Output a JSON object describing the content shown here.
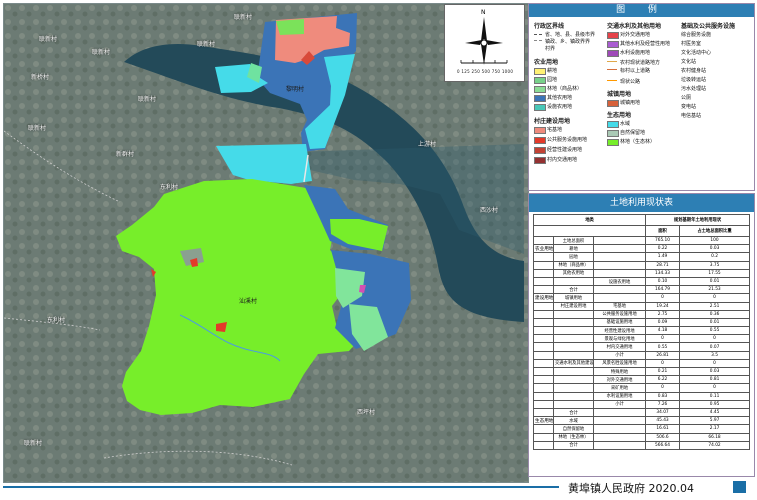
{
  "villages": [
    "联新村",
    "联新村",
    "联新村",
    "联新村",
    "新桥村",
    "联新村",
    "联新村",
    "新群村",
    "黎明村",
    "上游村",
    "西沙村",
    "西坪村",
    "东利村",
    "联新村",
    "汕溪村",
    "东利村"
  ],
  "legend": {
    "title": "图 例",
    "admin": {
      "title": "行政区界线",
      "items": [
        "省、地、县、县级市界",
        "镇政、乡、镇政界界",
        "村界"
      ]
    },
    "agri": {
      "title": "农业用地",
      "items": [
        "耕地",
        "园地",
        "林地（商品林）",
        "其他农用地",
        "设施农用地"
      ]
    },
    "village": {
      "title": "村庄建设用地",
      "items": [
        "宅基地",
        "公共服务设施用地",
        "经营性建设用地",
        "村内交通用地"
      ]
    },
    "traffic": {
      "title": "交通水利及其他用地",
      "items": [
        "对外交通用地",
        "其他水利及经营性用地",
        "水利设施用地",
        "农村现状道路地方",
        "标村以上道路",
        "现状公路"
      ]
    },
    "town": {
      "title": "城镇用地",
      "items": [
        "城镇用地"
      ]
    },
    "eco": {
      "title": "生态用地",
      "items": [
        "水域",
        "自然保留地",
        "林地（生态林）"
      ]
    },
    "facility": {
      "title": "基础及公共服务设施",
      "items": [
        "综合服务设施",
        "村医务室",
        "文化活动中心",
        "文化站",
        "农村健身站",
        "垃圾转运站",
        "污水处理站",
        "公厕",
        "变电站",
        "电信基站"
      ]
    }
  },
  "compass": {
    "north": "N",
    "scale": "0 125 250 500 750 1000"
  },
  "table": {
    "title": "土地利用现状表",
    "headers": [
      "地类",
      "",
      "规划基期年土地利用现状",
      ""
    ],
    "subheaders": [
      "面积",
      "占土地总面积比重"
    ],
    "rows": [
      [
        "",
        "土地总面积",
        "",
        "765.10",
        "100"
      ],
      [
        "农业用地",
        "耕地",
        "",
        "0.22",
        "0.03"
      ],
      [
        "",
        "园地",
        "",
        "1.49",
        "0.2"
      ],
      [
        "",
        "林地（商品林）",
        "",
        "28.71",
        "3.75"
      ],
      [
        "",
        "其他农用地",
        "",
        "134.33",
        "17.55"
      ],
      [
        "",
        "",
        "设施农用地",
        "0.10",
        "0.01"
      ],
      [
        "",
        "合计",
        "",
        "164.79",
        "21.53"
      ],
      [
        "建设用地",
        "城镇用地",
        "",
        "0",
        "0"
      ],
      [
        "",
        "村庄建设用地",
        "宅基地",
        "19.24",
        "2.51"
      ],
      [
        "",
        "",
        "公共服务设施用地",
        "2.75",
        "0.36"
      ],
      [
        "",
        "",
        "基础设施用地",
        "0.09",
        "0.01"
      ],
      [
        "",
        "",
        "经营性建设用地",
        "4.18",
        "0.55"
      ],
      [
        "",
        "",
        "景观与绿化用地",
        "0",
        "0"
      ],
      [
        "",
        "",
        "村内交通用地",
        "0.55",
        "0.07"
      ],
      [
        "",
        "",
        "小计",
        "26.81",
        "3.5"
      ],
      [
        "",
        "交通水利及其他建设用地",
        "风景名胜设施用地",
        "0",
        "0"
      ],
      [
        "",
        "",
        "特殊用地",
        "0.21",
        "0.03"
      ],
      [
        "",
        "",
        "对外交通用地",
        "6.22",
        "0.81"
      ],
      [
        "",
        "",
        "采矿用地",
        "0",
        "0"
      ],
      [
        "",
        "",
        "水利设施用地",
        "0.83",
        "0.11"
      ],
      [
        "",
        "",
        "小计",
        "7.26",
        "0.95"
      ],
      [
        "",
        "合计",
        "",
        "34.07",
        "4.45"
      ],
      [
        "生态用地",
        "水域",
        "",
        "45.43",
        "5.97"
      ],
      [
        "",
        "自然保留地",
        "",
        "16.61",
        "2.17"
      ],
      [
        "",
        "林地（生态林）",
        "",
        "506.6",
        "66.18"
      ],
      [
        "",
        "合计",
        "",
        "566.64",
        "74.02"
      ]
    ]
  },
  "footer": {
    "org": "黄埠镇人民政府",
    "date": "2020.04"
  },
  "colors": {
    "accent": "#2d7fb4",
    "green": "#77ee2a",
    "blue": "#3b74b7",
    "cyan": "#45dbe9"
  }
}
